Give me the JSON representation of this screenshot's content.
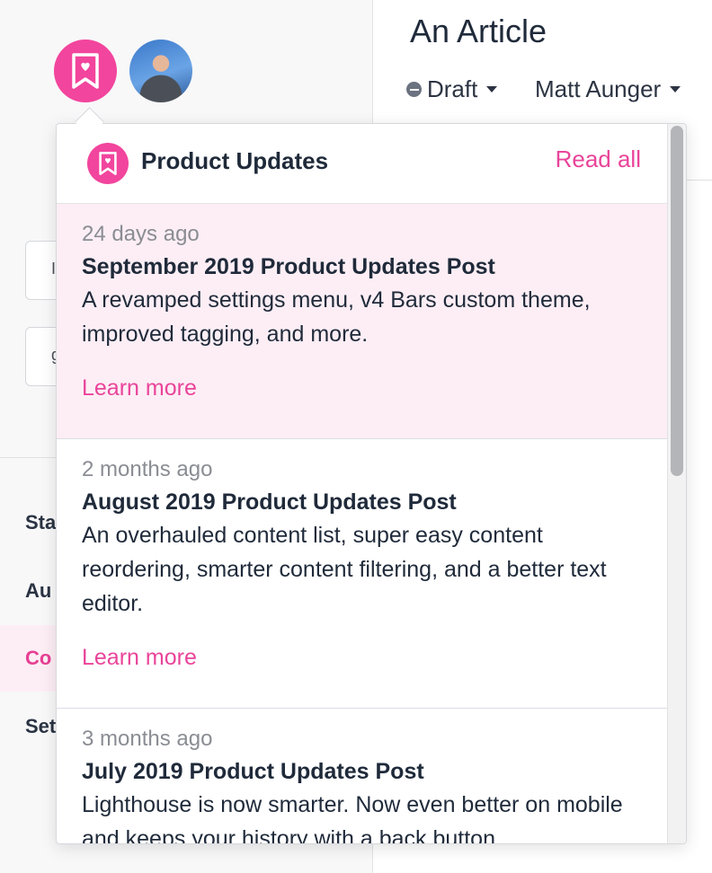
{
  "header": {
    "article_title": "An Article",
    "status_label": "Draft",
    "author_label": "Matt Aunger"
  },
  "sidebar": {
    "field_stub_1": "I",
    "field_stub_2": "g",
    "items": [
      {
        "label": "Sta"
      },
      {
        "label": "Au"
      },
      {
        "label": "Co"
      },
      {
        "label": "Set"
      }
    ]
  },
  "popover": {
    "title": "Product Updates",
    "read_all": "Read all",
    "posts": [
      {
        "date": "24 days ago",
        "title": "September 2019 Product Updates Post",
        "summary": "A revamped settings menu, v4 Bars custom theme, improved tagging, and more.",
        "link": "Learn more"
      },
      {
        "date": "2 months ago",
        "title": "August 2019 Product Updates Post",
        "summary": "An overhauled content list, super easy content reordering, smarter content filtering, and a better text editor.",
        "link": "Learn more"
      },
      {
        "date": "3 months ago",
        "title": "July 2019 Product Updates Post",
        "summary": "Lighthouse is now smarter. Now even better on mobile and keeps your history with a back button.",
        "link": ""
      }
    ]
  },
  "colors": {
    "accent": "#e9449a",
    "brand": "#f2459d",
    "unread_bg": "#fdeef5"
  },
  "icons": {
    "brand": "bookmark-heart-icon",
    "status": "minus-circle-icon",
    "caret": "caret-down-icon"
  }
}
